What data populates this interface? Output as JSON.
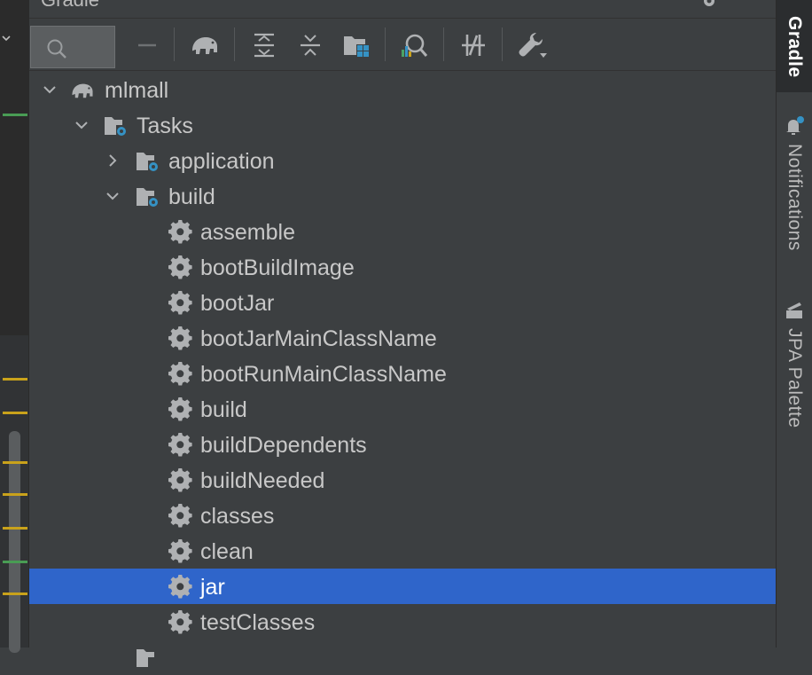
{
  "panel": {
    "title": "Gradle"
  },
  "toolbar": {
    "buttons": [
      {
        "name": "search",
        "icon": "search-icon"
      },
      {
        "name": "collapse",
        "icon": "minus-icon"
      },
      {
        "name": "gradle-elephant",
        "icon": "elephant-icon"
      },
      {
        "name": "expand-all",
        "icon": "expand-all-icon"
      },
      {
        "name": "collapse-all",
        "icon": "collapse-all-icon"
      },
      {
        "name": "dependencies",
        "icon": "folder-grid-icon"
      },
      {
        "name": "analyze",
        "icon": "analyze-icon"
      },
      {
        "name": "toggle-offline",
        "icon": "offline-icon"
      },
      {
        "name": "settings",
        "icon": "wrench-icon"
      }
    ]
  },
  "tree": {
    "project": "mlmall",
    "tasks_group": "Tasks",
    "groups": [
      {
        "label": "application",
        "expanded": false
      },
      {
        "label": "build",
        "expanded": true
      }
    ],
    "build_tasks": [
      "assemble",
      "bootBuildImage",
      "bootJar",
      "bootJarMainClassName",
      "bootRunMainClassName",
      "build",
      "buildDependents",
      "buildNeeded",
      "classes",
      "clean",
      "jar",
      "testClasses"
    ],
    "selected": "jar"
  },
  "right_strip": {
    "tabs": [
      {
        "label": "Gradle",
        "active": true
      },
      {
        "label": "Notifications",
        "active": false
      },
      {
        "label": "JPA Palette",
        "active": false
      }
    ]
  },
  "colors": {
    "background": "#3c3f41",
    "selection": "#2f65ca",
    "icon_gray": "#afb1b3",
    "accent_blue": "#3592c4"
  }
}
